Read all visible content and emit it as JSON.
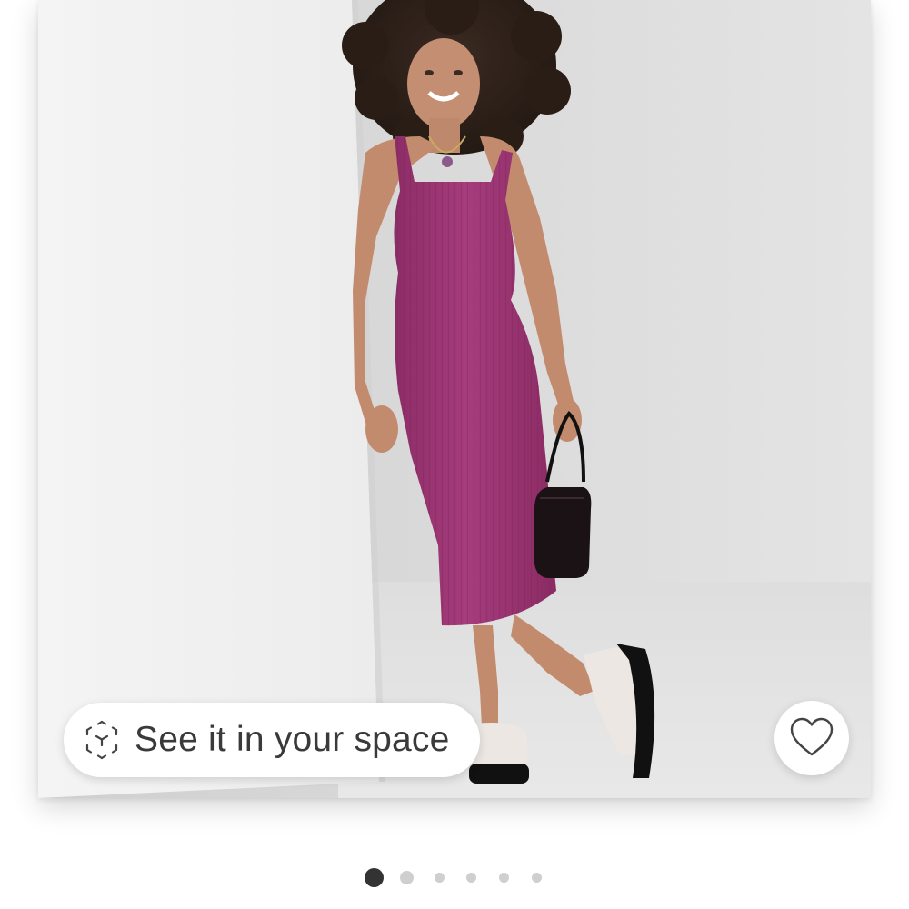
{
  "product_image": {
    "alt": "",
    "dress_color": "#a23a78",
    "background_color": "#d6d6d6"
  },
  "ar_button": {
    "label": "See it in your space",
    "icon": "ar-cube-icon"
  },
  "favorite_button": {
    "icon": "heart-outline-icon"
  },
  "carousel": {
    "total": 6,
    "active_index": 0,
    "active_color": "#333333",
    "inactive_color": "#cfcfcf"
  }
}
